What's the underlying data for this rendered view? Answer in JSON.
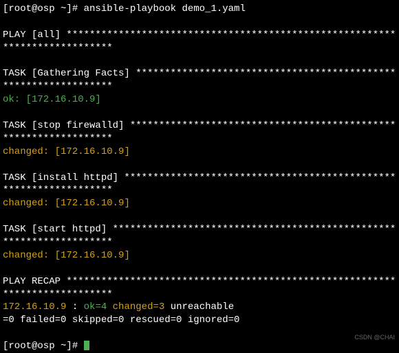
{
  "command_line": {
    "prompt": "[root@osp ~]# ",
    "command": "ansible-playbook demo_1.yaml"
  },
  "play_header": {
    "line1": "PLAY [all] *********************************************************",
    "line2": "*******************"
  },
  "task_gathering": {
    "line1": "TASK [Gathering Facts] *********************************************",
    "line2": "*******************",
    "status": "ok: [172.16.10.9]"
  },
  "task_stop_firewalld": {
    "line1": "TASK [stop firewalld] **********************************************",
    "line2": "*******************",
    "status_label": "changed: ",
    "status_host": "[172.16.10.9]"
  },
  "task_install_httpd": {
    "line1": "TASK [install httpd] ***********************************************",
    "line2": "*******************",
    "status_label": "changed: ",
    "status_host": "[172.16.10.9]"
  },
  "task_start_httpd": {
    "line1": "TASK [start httpd] *************************************************",
    "line2": "*******************",
    "status_label": "changed: ",
    "status_host": "[172.16.10.9]"
  },
  "play_recap": {
    "line1": "PLAY RECAP *********************************************************",
    "line2": "*******************",
    "host": "172.16.10.9",
    "spacer": "               : ",
    "ok": "ok=4",
    "gap1": "    ",
    "changed": "changed=3",
    "gap2": "    ",
    "unreachable_part1": "unreachable",
    "recap_line2": "=0    failed=0    skipped=0    rescued=0    ignored=0"
  },
  "final_prompt": "[root@osp ~]# ",
  "watermark": "CSDN @CHAI"
}
